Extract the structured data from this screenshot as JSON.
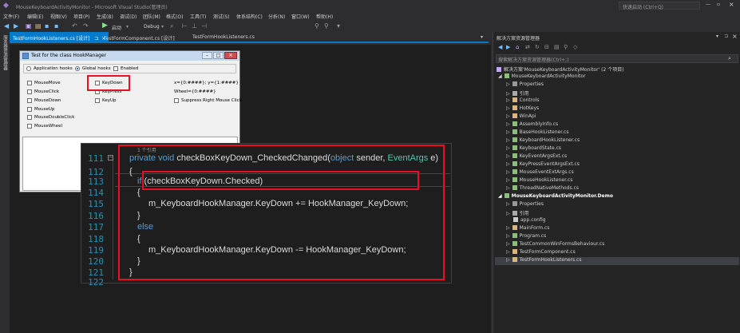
{
  "window": {
    "title": "MouseKeyboardActivityMonitor - Microsoft Visual Studio(管理员)",
    "quick_launch": "快速启动 (Ctrl+Q)"
  },
  "menu": [
    "文件(F)",
    "编辑(E)",
    "视图(V)",
    "项目(P)",
    "生成(B)",
    "调试(D)",
    "团队(M)",
    "格式(O)",
    "工具(T)",
    "测试(S)",
    "体系结构(C)",
    "分析(N)",
    "窗口(W)",
    "帮助(H)"
  ],
  "toolbar": {
    "start_label": "启动",
    "config_label": "Debug"
  },
  "tabs": [
    {
      "label": "TestFormHookListeners.cs [设计]",
      "active": true
    },
    {
      "label": "TestFormComponent.cs [设计]",
      "active": false
    },
    {
      "label": "TestFormHookListeners.cs",
      "active": false
    }
  ],
  "left_strip_label": "服务器资源管理器",
  "form": {
    "title": "Test for the class HookManager",
    "radios": [
      {
        "label": "Application hooks",
        "checked": false
      },
      {
        "label": "Global hooks",
        "checked": true
      }
    ],
    "enabled_label": "Enabled",
    "col1": [
      "MouseMove",
      "MouseClick",
      "MouseDown",
      "MouseUp",
      "MouseDoubleClick",
      "MouseWheel"
    ],
    "col2": [
      "KeyDown",
      "KeyPress",
      "KeyUp"
    ],
    "coords": "x={0:####}; y={1:####}",
    "wheel": "Wheel={0:####}",
    "suppress": "Suppress Right Mouse Click"
  },
  "code": {
    "refs": "1 个引用",
    "lines": [
      {
        "n": "111",
        "text": "private void checkBoxKeyDown_CheckedChanged(object sender, EventArgs e)"
      },
      {
        "n": "112",
        "text": "{"
      },
      {
        "n": "113",
        "text": "if (checkBoxKeyDown.Checked)"
      },
      {
        "n": "114",
        "text": "{"
      },
      {
        "n": "115",
        "text": "m_KeyboardHookManager.KeyDown += HookManager_KeyDown;"
      },
      {
        "n": "116",
        "text": "}"
      },
      {
        "n": "117",
        "text": "else"
      },
      {
        "n": "118",
        "text": "{"
      },
      {
        "n": "119",
        "text": "m_KeyboardHookManager.KeyDown -= HookManager_KeyDown;"
      },
      {
        "n": "120",
        "text": "}"
      },
      {
        "n": "121",
        "text": "}"
      },
      {
        "n": "122",
        "text": ""
      }
    ]
  },
  "solution": {
    "panel_title": "解决方案资源管理器",
    "search_placeholder": "搜索解决方案资源管理器(Ctrl+;)",
    "root": "解决方案'MouseKeyboardActivityMonitor' (2 个项目)",
    "items": [
      "MouseKeyboardActivityMonitor",
      "Properties",
      "引用",
      "Controls",
      "HotKeys",
      "WinApi",
      "AssemblyInfo.cs",
      "BaseHookListener.cs",
      "KeyboardHookListener.cs",
      "KeyboardState.cs",
      "KeyEventArgsExt.cs",
      "KeyPressEventArgsExt.cs",
      "MouseEventExtArgs.cs",
      "MouseHookListener.cs",
      "ThreadNativeMethods.cs",
      "MouseKeyboardActivityMonitor.Demo",
      "Properties",
      "引用",
      "app.config",
      "MainForm.cs",
      "Program.cs",
      "TestCommonWinFormsBehaviour.cs",
      "TestFormComponent.cs",
      "TestFormHookListeners.cs"
    ]
  },
  "colors": {
    "accent": "#007acc",
    "highlight": "#e81123"
  }
}
